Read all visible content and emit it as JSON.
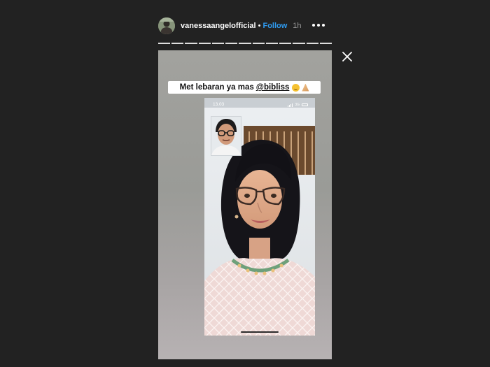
{
  "header": {
    "username": "vanessaangelofficial",
    "separator": "•",
    "follow_label": "Follow",
    "time": "1h"
  },
  "progress": {
    "segments": 13,
    "current": 13
  },
  "story": {
    "caption_text": "Met lebaran ya mas",
    "caption_mention": "@bibliss",
    "caption_emojis": [
      "smiling-face-emoji",
      "folded-hands-emoji"
    ],
    "call": {
      "status_time": "13.03",
      "network": "3G"
    }
  },
  "icons": {
    "more": "more-options-icon",
    "close": "close-icon"
  },
  "colors": {
    "background": "#222222",
    "follow": "#2f9bf0",
    "text": "#ffffff"
  }
}
